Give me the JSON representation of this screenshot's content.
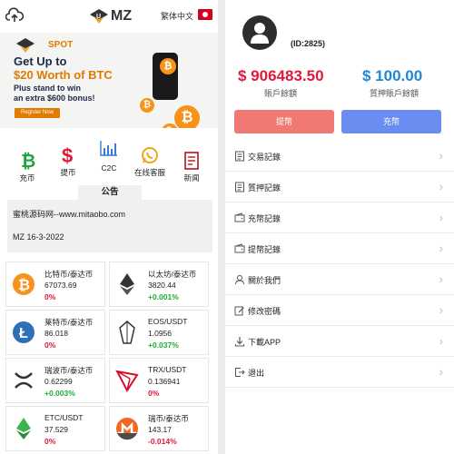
{
  "header": {
    "brand": "MZ",
    "language": "繁体中文",
    "icons": {
      "left": "cloud-upload-icon",
      "flag": "hong-kong-flag-icon"
    }
  },
  "banner": {
    "spot": "SPOT",
    "line1": "Get Up to",
    "line2": "$20 Worth of BTC",
    "line3a": "Plus stand to win",
    "line3b": "an extra $600 bonus!",
    "register": "Register Now"
  },
  "quick_nav": [
    {
      "label": "充币",
      "icon": "bitcoin-icon"
    },
    {
      "label": "提币",
      "icon": "dollar-icon"
    },
    {
      "label": "C2C",
      "icon": "chart-icon"
    },
    {
      "label": "在线客服",
      "icon": "whatsapp-icon"
    },
    {
      "label": "新闻",
      "icon": "news-icon"
    }
  ],
  "notice": {
    "title": "公告",
    "line1": "蜜桃源码网--www.mitaobo.com",
    "line2": "MZ 16-3-2022"
  },
  "markets": [
    {
      "pair": "比特币/泰达币",
      "price": "67073.69",
      "change": "0%",
      "trend": "down",
      "icon": "bitcoin-coin-icon",
      "color": "#f7931a"
    },
    {
      "pair": "以太坊/泰达币",
      "price": "3820.44",
      "change": "+0.001%",
      "trend": "up",
      "icon": "ethereum-coin-icon",
      "color": "#333333"
    },
    {
      "pair": "莱特币/泰达币",
      "price": "86.018",
      "change": "0%",
      "trend": "down",
      "icon": "litecoin-coin-icon",
      "color": "#2e6fb7"
    },
    {
      "pair": "EOS/USDT",
      "price": "1.0956",
      "change": "+0.037%",
      "trend": "up",
      "icon": "eos-coin-icon",
      "color": "#333333"
    },
    {
      "pair": "瑞波币/泰达币",
      "price": "0.62299",
      "change": "+0.003%",
      "trend": "up",
      "icon": "ripple-coin-icon",
      "color": "#333333"
    },
    {
      "pair": "TRX/USDT",
      "price": "0.136941",
      "change": "0%",
      "trend": "down",
      "icon": "tron-coin-icon",
      "color": "#d80e2a"
    },
    {
      "pair": "ETC/USDT",
      "price": "37.529",
      "change": "0%",
      "trend": "down",
      "icon": "ethereum-classic-coin-icon",
      "color": "#3cb54a"
    },
    {
      "pair": "瑞币/泰达币",
      "price": "143.17",
      "change": "-0.014%",
      "trend": "down",
      "icon": "monero-coin-icon",
      "color": "#f26822"
    }
  ],
  "account": {
    "uid": "(ID:2825)",
    "balance": "$ 906483.50",
    "balance_label": "賬戶餘額",
    "pledge": "$ 100.00",
    "pledge_label": "質押賬戶餘額",
    "withdraw": "提幣",
    "deposit": "充幣"
  },
  "menu": [
    {
      "label": "交易記錄",
      "icon": "document-icon"
    },
    {
      "label": "質押記錄",
      "icon": "document-icon"
    },
    {
      "label": "充幣記錄",
      "icon": "wallet-icon"
    },
    {
      "label": "提幣記錄",
      "icon": "wallet-icon"
    },
    {
      "label": "關於我們",
      "icon": "user-icon"
    },
    {
      "label": "修改密碼",
      "icon": "edit-icon"
    },
    {
      "label": "下載APP",
      "icon": "download-icon"
    },
    {
      "label": "退出",
      "icon": "logout-icon"
    }
  ],
  "colors": {
    "red": "#e0193a",
    "green": "#1fad35",
    "blue": "#1e88d8",
    "withdraw_btn": "#f07a73",
    "deposit_btn": "#6b8cf0"
  }
}
